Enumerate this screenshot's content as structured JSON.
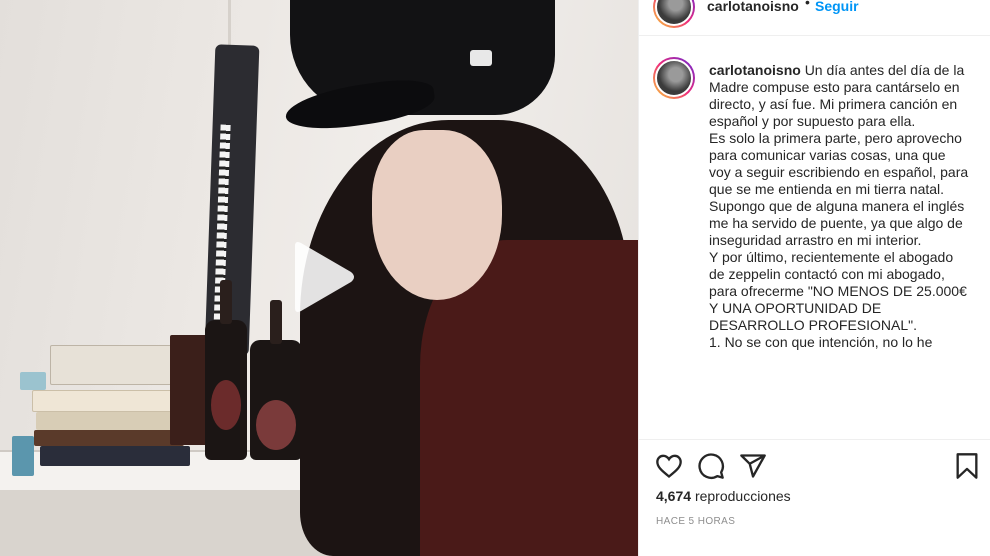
{
  "post": {
    "username": "carlotanoisno",
    "follow_label": "Seguir",
    "caption_lines": [
      "Un día antes del día de la Madre compuse esto para cantárselo en directo, y así fue. Mi primera canción en español y por supuesto para ella.",
      "Es solo la primera parte, pero aprovecho para comunicar varias cosas, una que voy a seguir escribiendo en español, para que se me entienda en mi tierra natal.",
      "Supongo que de alguna manera el inglés me ha servido de puente, ya que algo de inseguridad arrastro en mi interior.",
      "Y por último, recientemente el abogado de zeppelin contactó con mi abogado, para ofrecerme \"NO MENOS DE 25.000€ Y UNA OPORTUNIDAD DE DESARROLLO PROFESIONAL\".",
      "1. No se con que intención, no lo he"
    ],
    "views_count": "4,674",
    "views_label": "reproducciones",
    "timestamp": "HACE 5 HORAS"
  },
  "icons": {
    "play": "play-icon",
    "like": "heart-icon",
    "comment": "comment-icon",
    "share": "share-icon",
    "save": "bookmark-icon"
  },
  "colors": {
    "follow_blue": "#0095f6",
    "text": "#262626",
    "muted": "#8e8e8e"
  }
}
